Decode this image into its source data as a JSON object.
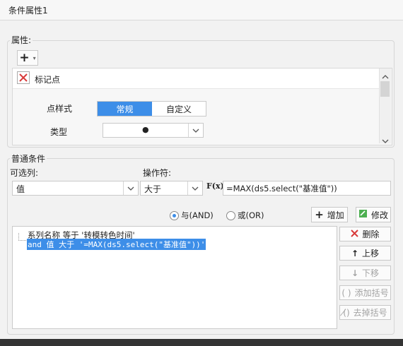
{
  "window": {
    "title": "条件属性1"
  },
  "properties": {
    "group_label": "属性:",
    "add_button": "+",
    "marker_item": "标记点",
    "point_style_label": "点样式",
    "point_style_tabs": [
      "常规",
      "自定义"
    ],
    "type_label": "类型",
    "type_value": "●"
  },
  "condition": {
    "group_label": "普通条件",
    "column_label": "可选列:",
    "column_value": "值",
    "operator_label": "操作符:",
    "operator_value": "大于",
    "formula_icon": "F(x)",
    "formula_value": "=MAX(ds5.select(\"基准值\"))",
    "and_label": "与(AND)",
    "or_label": "或(OR)",
    "add_btn": "增加",
    "modify_btn": "修改",
    "list": [
      "系列名称 等于 '转模转色时间'",
      "and 值 大于 '=MAX(ds5.select(\"基准值\"))'"
    ],
    "actions": [
      "删除",
      "上移",
      "下移",
      "添加括号",
      "去掉括号"
    ]
  }
}
